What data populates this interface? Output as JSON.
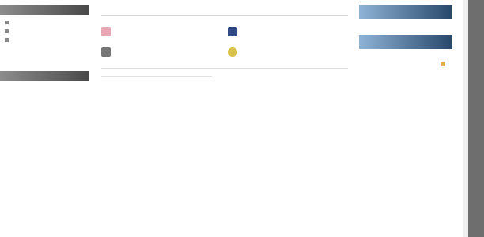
{
  "left": {
    "panel1": {
      "items": [
        "",
        "",
        ""
      ]
    },
    "panel2": {
      "lines": [
        "",
        "",
        "",
        "",
        ""
      ]
    }
  },
  "center": {
    "header": "",
    "tiles": [
      {
        "title": "",
        "lines": [
          "",
          "",
          "",
          ""
        ],
        "icon": "pink-square-icon",
        "color": "#e9a6b5"
      },
      {
        "title": "",
        "lines": [
          "",
          "",
          "",
          ""
        ],
        "icon": "blue-square-icon",
        "color": "#2f4a86"
      },
      {
        "title": "",
        "lines": [
          "",
          "",
          "",
          ""
        ],
        "icon": "gray-square-icon",
        "color": "#777777"
      },
      {
        "title": "",
        "lines": [
          "",
          "",
          "",
          ""
        ],
        "icon": "yellow-circle-icon",
        "color": "#d8c24a"
      }
    ],
    "lower": {
      "heading": "",
      "subheading": "",
      "col1": [
        "",
        "",
        ""
      ],
      "col2": [
        ""
      ]
    }
  },
  "right": {
    "panel1": {
      "lines": [
        "",
        "",
        "",
        "",
        ""
      ]
    },
    "panel2": {
      "lines": [
        "",
        "",
        "",
        "",
        "",
        "",
        "",
        "",
        ""
      ]
    },
    "more_label": ""
  },
  "colors": {
    "left_bar": "#6a6a6a",
    "right_bar": "#2e5a8c",
    "hot_title": "#c85a6e"
  }
}
